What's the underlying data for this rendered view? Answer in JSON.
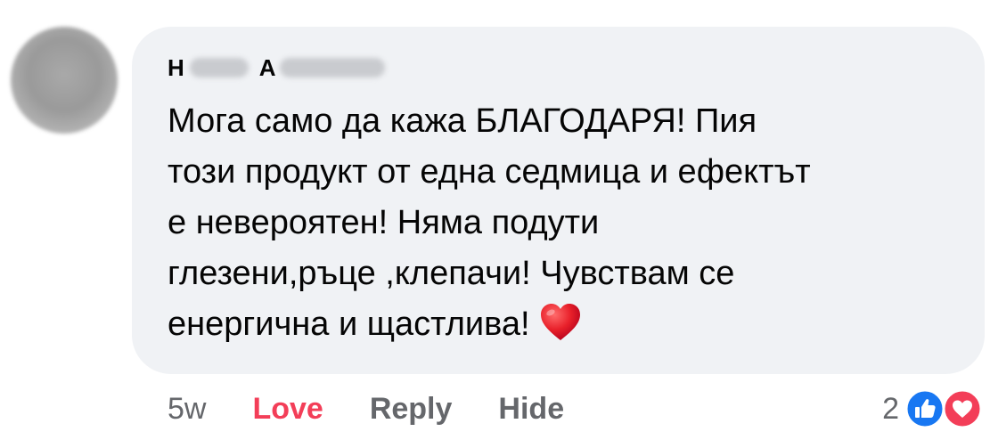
{
  "comment": {
    "author_first_initial": "H",
    "author_last_initial": "A",
    "text_lines": [
      "Мога само да кажа БЛАГОДАРЯ! Пия",
      "този продукт от една седмица и ефектът",
      "е невероятен! Няма подути",
      "глезени,ръце ,клепачи! Чувствам се",
      "енергична и щастлива!"
    ],
    "emoji": "red-heart-emoji"
  },
  "actions": {
    "time": "5w",
    "love_label": "Love",
    "reply_label": "Reply",
    "hide_label": "Hide"
  },
  "reactions": {
    "count": "2",
    "types": [
      "like-icon",
      "love-icon"
    ],
    "like_color": "#1877f2",
    "love_color": "#f33e58"
  },
  "colors": {
    "bubble": "#f0f2f5",
    "secondary_text": "#65676b",
    "love_active": "#f33e58"
  }
}
